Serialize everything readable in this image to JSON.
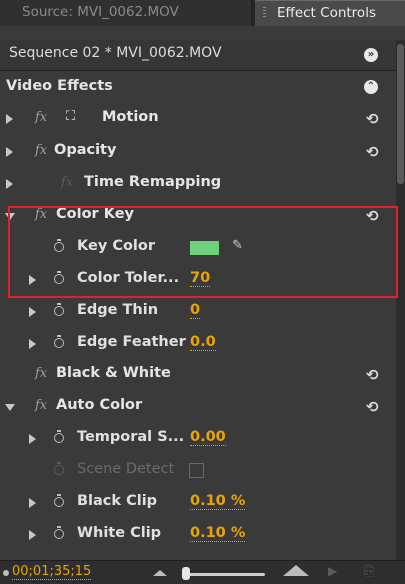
{
  "tabs": [
    {
      "label": "Source: MVI_0062.MOV",
      "active": false
    },
    {
      "label": "Effect Controls",
      "active": true
    }
  ],
  "sequence": {
    "title": "Sequence 02 * MVI_0062.MOV"
  },
  "video_effects": {
    "title": "Video Effects"
  },
  "effects": [
    {
      "name": "Motion",
      "expanded": false
    },
    {
      "name": "Opacity",
      "expanded": false
    },
    {
      "name": "Time Remapping",
      "expanded": false
    },
    {
      "name": "Color Key",
      "expanded": true
    },
    {
      "name": "Black & White",
      "expanded": false
    },
    {
      "name": "Auto Color",
      "expanded": true
    }
  ],
  "color_key": {
    "key_color": {
      "label": "Key Color",
      "color": "#6fd17c"
    },
    "color_tolerance": {
      "label": "Color Toler...",
      "value": "70"
    },
    "edge_thin": {
      "label": "Edge Thin",
      "value": "0"
    },
    "edge_feather": {
      "label": "Edge Feather",
      "value": "0.0"
    }
  },
  "auto_color": {
    "temporal": {
      "label": "Temporal S...",
      "value": "0.00"
    },
    "scene_detect": {
      "label": "Scene Detect",
      "checked": false
    },
    "black_clip": {
      "label": "Black Clip",
      "value": "0.10 %"
    },
    "white_clip": {
      "label": "White Clip",
      "value": "0.10 %"
    }
  },
  "footer": {
    "timecode": "00;01;35;15"
  },
  "icons": {
    "reset": "⟲",
    "panel_menu": "»",
    "collapse": "⌃",
    "eyedropper": "✎"
  },
  "colors": {
    "accent": "#e8a500",
    "highlight_box": "#e0202c",
    "panel_bg": "#3a3a3a"
  }
}
